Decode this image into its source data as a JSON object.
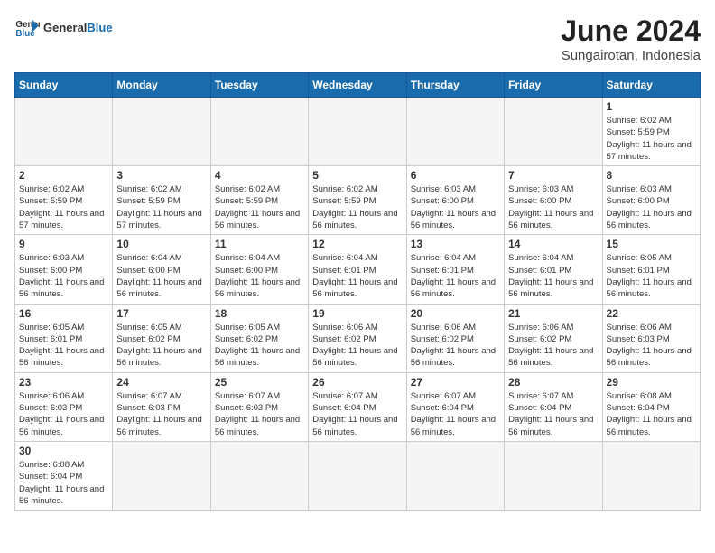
{
  "logo": {
    "text_general": "General",
    "text_blue": "Blue"
  },
  "title": "June 2024",
  "subtitle": "Sungairotan, Indonesia",
  "days_of_week": [
    "Sunday",
    "Monday",
    "Tuesday",
    "Wednesday",
    "Thursday",
    "Friday",
    "Saturday"
  ],
  "weeks": [
    [
      {
        "day": "",
        "empty": true
      },
      {
        "day": "",
        "empty": true
      },
      {
        "day": "",
        "empty": true
      },
      {
        "day": "",
        "empty": true
      },
      {
        "day": "",
        "empty": true
      },
      {
        "day": "",
        "empty": true
      },
      {
        "day": "1",
        "sunrise": "6:02 AM",
        "sunset": "5:59 PM",
        "daylight": "11 hours and 57 minutes."
      }
    ],
    [
      {
        "day": "2",
        "sunrise": "6:02 AM",
        "sunset": "5:59 PM",
        "daylight": "11 hours and 57 minutes."
      },
      {
        "day": "3",
        "sunrise": "6:02 AM",
        "sunset": "5:59 PM",
        "daylight": "11 hours and 57 minutes."
      },
      {
        "day": "4",
        "sunrise": "6:02 AM",
        "sunset": "5:59 PM",
        "daylight": "11 hours and 56 minutes."
      },
      {
        "day": "5",
        "sunrise": "6:02 AM",
        "sunset": "5:59 PM",
        "daylight": "11 hours and 56 minutes."
      },
      {
        "day": "6",
        "sunrise": "6:03 AM",
        "sunset": "6:00 PM",
        "daylight": "11 hours and 56 minutes."
      },
      {
        "day": "7",
        "sunrise": "6:03 AM",
        "sunset": "6:00 PM",
        "daylight": "11 hours and 56 minutes."
      },
      {
        "day": "8",
        "sunrise": "6:03 AM",
        "sunset": "6:00 PM",
        "daylight": "11 hours and 56 minutes."
      }
    ],
    [
      {
        "day": "9",
        "sunrise": "6:03 AM",
        "sunset": "6:00 PM",
        "daylight": "11 hours and 56 minutes."
      },
      {
        "day": "10",
        "sunrise": "6:04 AM",
        "sunset": "6:00 PM",
        "daylight": "11 hours and 56 minutes."
      },
      {
        "day": "11",
        "sunrise": "6:04 AM",
        "sunset": "6:00 PM",
        "daylight": "11 hours and 56 minutes."
      },
      {
        "day": "12",
        "sunrise": "6:04 AM",
        "sunset": "6:01 PM",
        "daylight": "11 hours and 56 minutes."
      },
      {
        "day": "13",
        "sunrise": "6:04 AM",
        "sunset": "6:01 PM",
        "daylight": "11 hours and 56 minutes."
      },
      {
        "day": "14",
        "sunrise": "6:04 AM",
        "sunset": "6:01 PM",
        "daylight": "11 hours and 56 minutes."
      },
      {
        "day": "15",
        "sunrise": "6:05 AM",
        "sunset": "6:01 PM",
        "daylight": "11 hours and 56 minutes."
      }
    ],
    [
      {
        "day": "16",
        "sunrise": "6:05 AM",
        "sunset": "6:01 PM",
        "daylight": "11 hours and 56 minutes."
      },
      {
        "day": "17",
        "sunrise": "6:05 AM",
        "sunset": "6:02 PM",
        "daylight": "11 hours and 56 minutes."
      },
      {
        "day": "18",
        "sunrise": "6:05 AM",
        "sunset": "6:02 PM",
        "daylight": "11 hours and 56 minutes."
      },
      {
        "day": "19",
        "sunrise": "6:06 AM",
        "sunset": "6:02 PM",
        "daylight": "11 hours and 56 minutes."
      },
      {
        "day": "20",
        "sunrise": "6:06 AM",
        "sunset": "6:02 PM",
        "daylight": "11 hours and 56 minutes."
      },
      {
        "day": "21",
        "sunrise": "6:06 AM",
        "sunset": "6:02 PM",
        "daylight": "11 hours and 56 minutes."
      },
      {
        "day": "22",
        "sunrise": "6:06 AM",
        "sunset": "6:03 PM",
        "daylight": "11 hours and 56 minutes."
      }
    ],
    [
      {
        "day": "23",
        "sunrise": "6:06 AM",
        "sunset": "6:03 PM",
        "daylight": "11 hours and 56 minutes."
      },
      {
        "day": "24",
        "sunrise": "6:07 AM",
        "sunset": "6:03 PM",
        "daylight": "11 hours and 56 minutes."
      },
      {
        "day": "25",
        "sunrise": "6:07 AM",
        "sunset": "6:03 PM",
        "daylight": "11 hours and 56 minutes."
      },
      {
        "day": "26",
        "sunrise": "6:07 AM",
        "sunset": "6:04 PM",
        "daylight": "11 hours and 56 minutes."
      },
      {
        "day": "27",
        "sunrise": "6:07 AM",
        "sunset": "6:04 PM",
        "daylight": "11 hours and 56 minutes."
      },
      {
        "day": "28",
        "sunrise": "6:07 AM",
        "sunset": "6:04 PM",
        "daylight": "11 hours and 56 minutes."
      },
      {
        "day": "29",
        "sunrise": "6:08 AM",
        "sunset": "6:04 PM",
        "daylight": "11 hours and 56 minutes."
      }
    ],
    [
      {
        "day": "30",
        "sunrise": "6:08 AM",
        "sunset": "6:04 PM",
        "daylight": "11 hours and 56 minutes."
      },
      {
        "day": "",
        "empty": true
      },
      {
        "day": "",
        "empty": true
      },
      {
        "day": "",
        "empty": true
      },
      {
        "day": "",
        "empty": true
      },
      {
        "day": "",
        "empty": true
      },
      {
        "day": "",
        "empty": true
      }
    ]
  ]
}
